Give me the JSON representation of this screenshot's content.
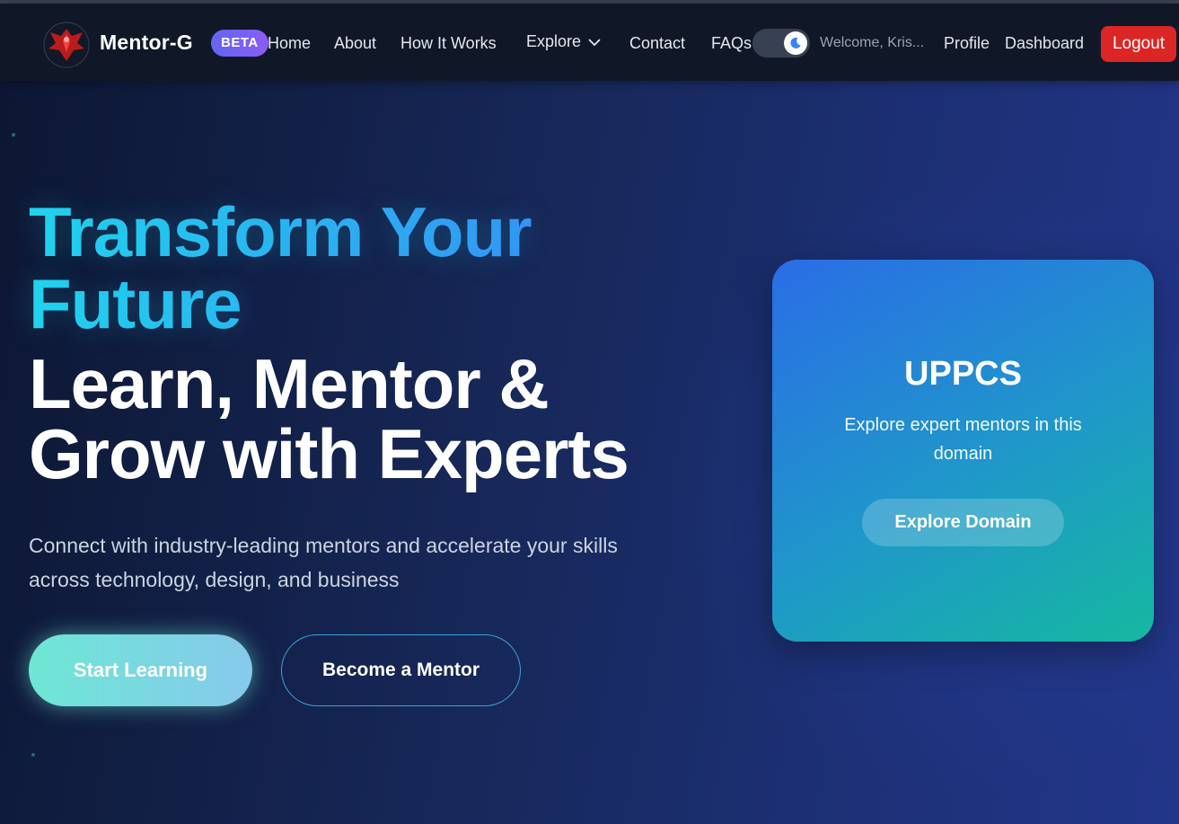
{
  "nav": {
    "brand": "Mentor-G",
    "badge": "BETA",
    "links": [
      "Home",
      "About",
      "How It Works",
      "Explore",
      "Contact",
      "FAQs"
    ],
    "welcome": "Welcome, Kris...",
    "profile": "Profile",
    "dashboard": "Dashboard",
    "logout": "Logout",
    "theme_toggle": "dark"
  },
  "hero": {
    "headline_gradient": "Transform Your Future",
    "headline_white": "Learn, Mentor & Grow with Experts",
    "subtitle": "Connect with industry-leading mentors and accelerate your skills across technology, design, and business",
    "primary_cta": "Start Learning",
    "secondary_cta": "Become a Mentor"
  },
  "card": {
    "title": "UPPCS",
    "description": "Explore expert mentors in this domain",
    "button": "Explore Domain"
  },
  "colors": {
    "navbar_bg": "#101828",
    "logout_bg": "#dc2626",
    "badge_from": "#6366f1",
    "badge_to": "#8b5cf6",
    "accent_cyan": "#22d3ee",
    "accent_blue": "#3b82f6"
  }
}
